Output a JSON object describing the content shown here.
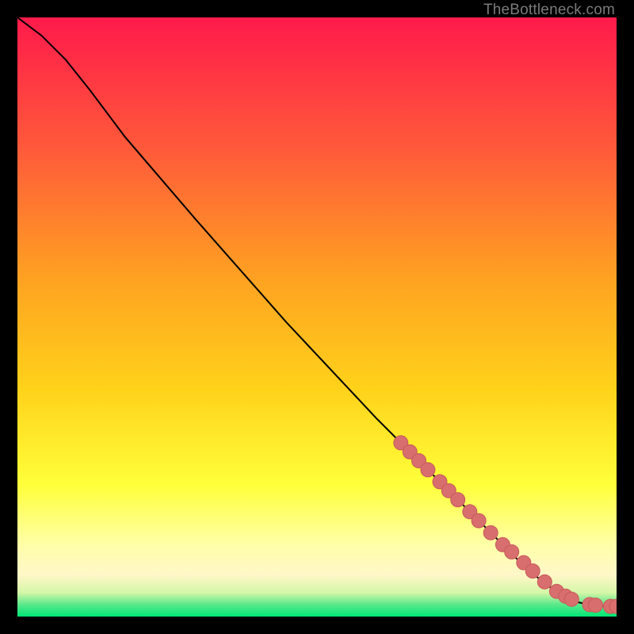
{
  "attribution": "TheBottleneck.com",
  "colors": {
    "gradient_top": "#ff1a4b",
    "gradient_mid_upper": "#ff7a2f",
    "gradient_mid": "#ffd21a",
    "gradient_lower": "#ffff7a",
    "gradient_cream": "#fff7c8",
    "gradient_bottom": "#00e676",
    "curve": "#000000",
    "marker_fill": "#d86e6e",
    "marker_stroke": "#c85a5a"
  },
  "chart_data": {
    "type": "line",
    "title": "",
    "xlabel": "",
    "ylabel": "",
    "xlim": [
      0,
      100
    ],
    "ylim": [
      0,
      100
    ],
    "series": [
      {
        "name": "curve",
        "x": [
          0,
          4,
          8,
          12,
          18,
          30,
          45,
          60,
          70,
          78,
          84,
          88,
          91,
          93.5,
          95.5,
          97,
          98.5,
          100
        ],
        "y": [
          100,
          97,
          93,
          88,
          80,
          66,
          49,
          33,
          23,
          15,
          9,
          5.5,
          3.5,
          2.4,
          2.0,
          1.8,
          1.7,
          1.7
        ]
      }
    ],
    "markers": {
      "name": "highlighted-points",
      "x": [
        64,
        65.5,
        67,
        68.5,
        70.5,
        72,
        73.5,
        75.5,
        77,
        79,
        81,
        82.5,
        84.5,
        86,
        88,
        90,
        91.5,
        92.5,
        95.5,
        96.5,
        99,
        100
      ],
      "y": [
        29,
        27.5,
        26,
        24.5,
        22.5,
        21,
        19.5,
        17.5,
        16,
        14,
        12,
        10.8,
        9.0,
        7.6,
        5.8,
        4.2,
        3.4,
        2.9,
        2.0,
        1.9,
        1.7,
        1.7
      ]
    }
  }
}
